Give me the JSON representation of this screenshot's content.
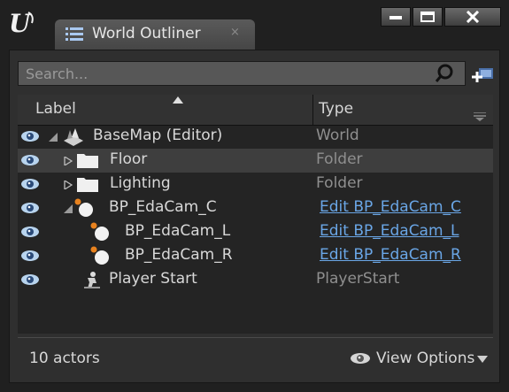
{
  "window": {
    "tab_title": "World Outliner",
    "tab_close_glyph": "×",
    "buttons": {
      "minimize": "▬",
      "maximize": "□",
      "close": "✕"
    }
  },
  "search": {
    "placeholder": "Search..."
  },
  "header": {
    "label_col": "Label",
    "type_col": "Type"
  },
  "rows": [
    {
      "name": "BaseMap (Editor)",
      "type": "World",
      "icon": "world-icon",
      "expander": "expanded"
    },
    {
      "name": "Floor",
      "type": "Folder",
      "icon": "folder-icon",
      "expander": "collapsed"
    },
    {
      "name": "Lighting",
      "type": "Folder",
      "icon": "folder-icon",
      "expander": "collapsed"
    },
    {
      "name": "BP_EdaCam_C",
      "type": "Edit BP_EdaCam_C",
      "icon": "actor-sphere-icon",
      "expander": "expanded"
    },
    {
      "name": "BP_EdaCam_L",
      "type": "Edit BP_EdaCam_L",
      "icon": "actor-sphere-icon",
      "expander": "none"
    },
    {
      "name": "BP_EdaCam_R",
      "type": "Edit BP_EdaCam_R",
      "icon": "actor-sphere-icon",
      "expander": "none"
    },
    {
      "name": "Player Start",
      "type": "PlayerStart",
      "icon": "player-start-icon",
      "expander": "none"
    }
  ],
  "footer": {
    "actor_count": "10 actors",
    "view_options": "View Options"
  },
  "colors": {
    "link": "#6aa6e6",
    "type_text": "#8f8f8f",
    "accent_orange": "#e8821e"
  }
}
